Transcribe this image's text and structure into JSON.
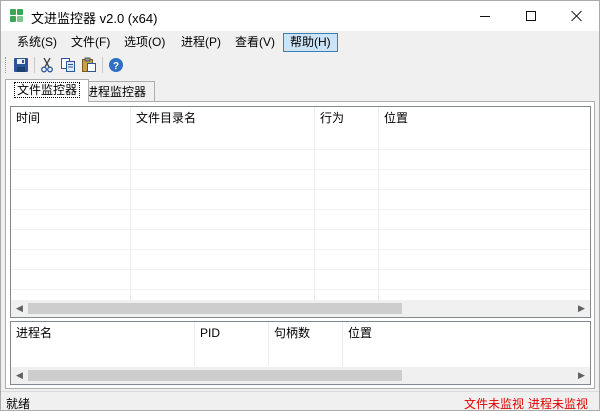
{
  "window": {
    "title": "文进监控器 v2.0 (x64)"
  },
  "menubar": {
    "items": [
      {
        "label": "系统(S)"
      },
      {
        "label": "文件(F)"
      },
      {
        "label": "选项(O)"
      },
      {
        "label": "进程(P)"
      },
      {
        "label": "查看(V)"
      },
      {
        "label": "帮助(H)"
      }
    ],
    "active_item": "帮助(H)"
  },
  "toolbar": {
    "buttons": [
      "save-icon",
      "cut-icon",
      "copy-icon",
      "paste-icon",
      "help-icon"
    ]
  },
  "tabs": [
    {
      "label": "文件监控器",
      "selected": true
    },
    {
      "label": "进程监控器",
      "selected": false
    }
  ],
  "file_table": {
    "columns": [
      "时间",
      "文件目录名",
      "行为",
      "位置"
    ],
    "rows": []
  },
  "process_table": {
    "columns": [
      "进程名",
      "PID",
      "句柄数",
      "位置"
    ],
    "rows": []
  },
  "statusbar": {
    "status": "就绪",
    "file_monitor_status": "文件未监视",
    "process_monitor_status": "进程未监视"
  },
  "colors": {
    "accent_green": "#3aa655",
    "warning_red": "#e00000",
    "menu_highlight": "#cce4f7"
  }
}
